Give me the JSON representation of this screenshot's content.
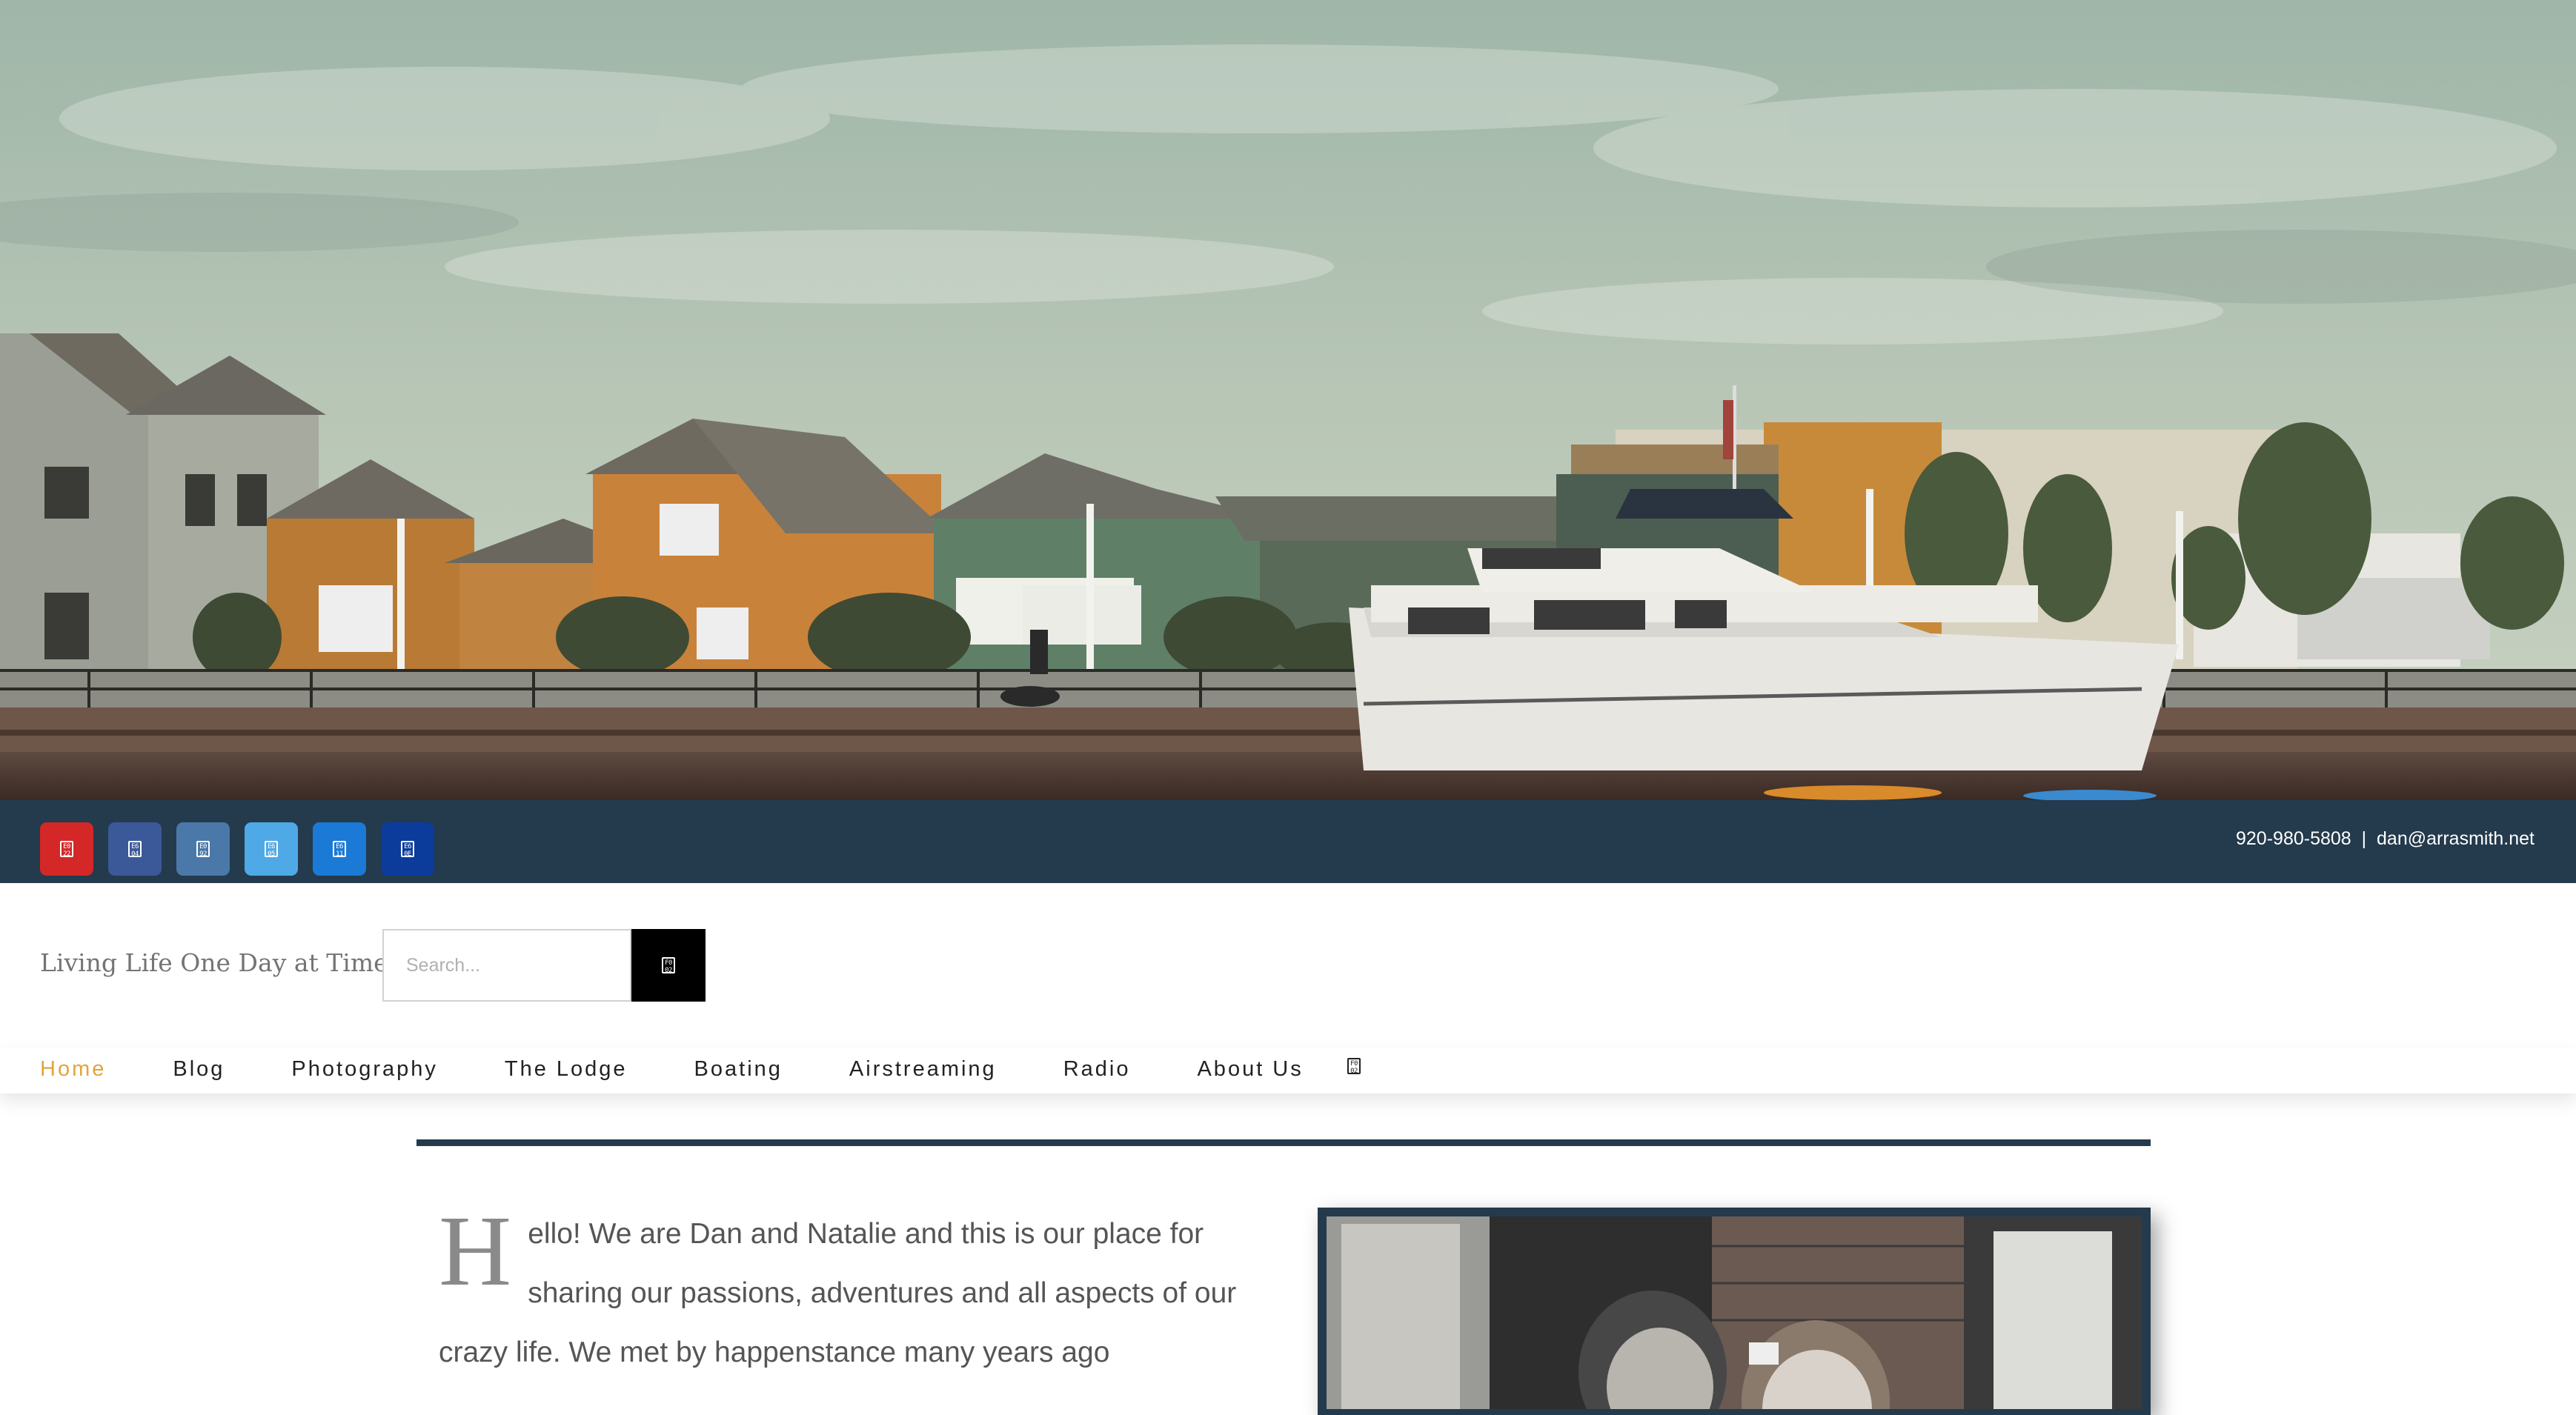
{
  "social": {
    "items": [
      {
        "name": "youtube",
        "color": "#d42728",
        "glyph": "E0\n22"
      },
      {
        "name": "facebook",
        "color": "#3b5998",
        "glyph": "E6\n04"
      },
      {
        "name": "instagram",
        "color": "#4a78a8",
        "glyph": "E0\n92"
      },
      {
        "name": "twitter",
        "color": "#4fa9e6",
        "glyph": "E6\n05"
      },
      {
        "name": "linkedin",
        "color": "#1a7ad6",
        "glyph": "E6\n11"
      },
      {
        "name": "paypal",
        "color": "#0b3c9c",
        "glyph": "E6\n0E"
      }
    ]
  },
  "contact": {
    "phone": "920-980-5808",
    "separator": "|",
    "email": "dan@arrasmith.net"
  },
  "header": {
    "tagline": "Living Life One Day at Time",
    "search_placeholder": "Search...",
    "search_glyph": "F0\n02"
  },
  "nav": {
    "items": [
      "Home",
      "Blog",
      "Photography",
      "The Lodge",
      "Boating",
      "Airstreaming",
      "Radio",
      "About Us"
    ],
    "active": "Home",
    "search_glyph": "F0\n02"
  },
  "content": {
    "dropcap": "H",
    "intro": "ello! We are Dan and Natalie and this is our place for sharing our passions, adventures and all aspects of our crazy life. We met by happenstance many years ago"
  },
  "colors": {
    "topbar": "#243a4d",
    "accent": "#e0a53c",
    "rule": "#243a4d"
  }
}
